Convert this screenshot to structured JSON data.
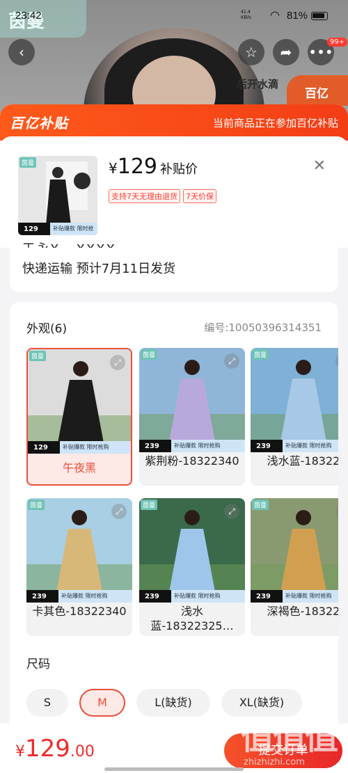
{
  "status_bar": {
    "time": "23:42",
    "network_speed": "41.4",
    "network_unit": "KB/s",
    "battery": "81%"
  },
  "background": {
    "brand_logo": "茵曼",
    "badge": "99+",
    "side_tag": "后开水滴",
    "subsidy_tag": "百亿"
  },
  "banner": {
    "logo": "百亿补贴",
    "text": "当前商品正在参加百亿补贴"
  },
  "product": {
    "price_symbol": "¥",
    "price": "129",
    "price_label": "补贴价",
    "tags": [
      "支持7天无理由退货",
      "7天价保"
    ]
  },
  "shipping": {
    "cut_text": "王永X · XXXX",
    "text": "快递运输  预计7月11日发货"
  },
  "appearance": {
    "title": "外观(6)",
    "code": "编号:10050396314351",
    "variants": [
      {
        "name": "午夜黑",
        "price": "129",
        "dress": "#1b1b1b",
        "bg": "#dcdcdc",
        "selected": true
      },
      {
        "name": "紫荆粉-18322340",
        "price": "239",
        "dress": "#b8a9dc",
        "bg": "#8fb6d8"
      },
      {
        "name": "浅水蓝-18322",
        "price": "239",
        "dress": "#a7c8e6",
        "bg": "#7fb0d6"
      },
      {
        "name": "卡其色-18322340",
        "price": "239",
        "dress": "#d8b878",
        "bg": "#a8cfe4"
      },
      {
        "name": "浅水蓝-18322325…",
        "price": "239",
        "dress": "#9dc6ea",
        "bg": "#3b6a4a"
      },
      {
        "name": "深褐色-18322",
        "price": "239",
        "dress": "#d0a050",
        "bg": "#8a9a70"
      }
    ],
    "brand_mini": "茵曼",
    "sub_text": "补贴爆款 限时抢购"
  },
  "size": {
    "title": "尺码",
    "options": [
      {
        "label": "S",
        "selected": false
      },
      {
        "label": "M",
        "selected": true
      },
      {
        "label": "L(缺货)",
        "selected": false
      },
      {
        "label": "XL(缺货)",
        "selected": false
      }
    ]
  },
  "bottom": {
    "symbol": "¥",
    "int": "129",
    "dec": ".00",
    "submit": "提交订单"
  },
  "watermark": {
    "big": "值值值",
    "small": "zhizhizhi.com"
  },
  "colors": {
    "accent": "#e9503a",
    "banner": "#f33d16",
    "price_red": "#ee2b2b"
  }
}
